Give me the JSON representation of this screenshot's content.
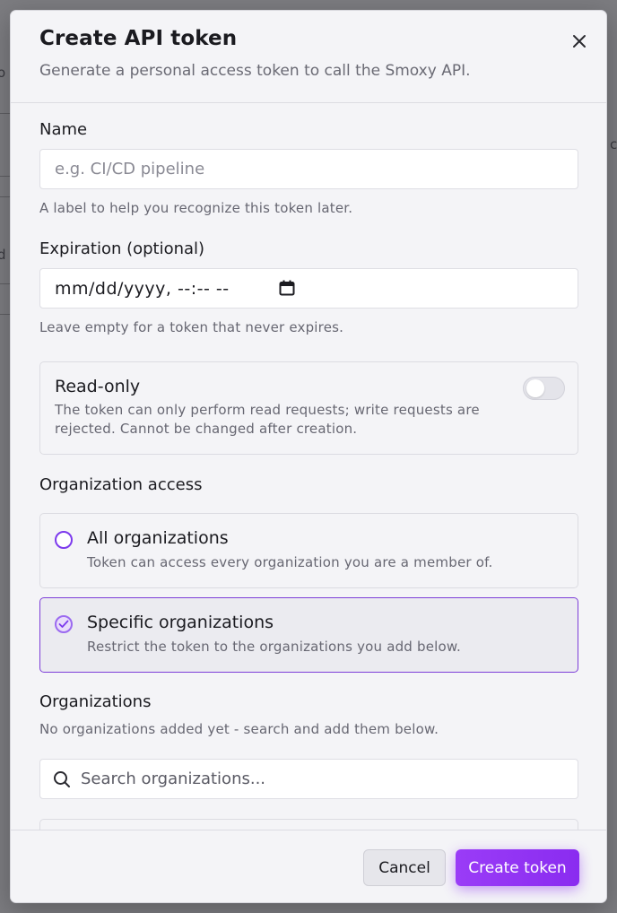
{
  "background": {
    "fragment_a": "o",
    "fragment_b": "d",
    "fragment_c": "c"
  },
  "dialog": {
    "title": "Create API token",
    "subtitle": "Generate a personal access token to call the Smoxy API.",
    "close_icon": "close-icon"
  },
  "name_field": {
    "label": "Name",
    "placeholder": "e.g. CI/CD pipeline",
    "hint": "A label to help you recognize this token later."
  },
  "expiration_field": {
    "label": "Expiration (optional)",
    "value": "mm/dd/yyyy, --:-- --",
    "calendar_icon": "calendar-icon",
    "hint": "Leave empty for a token that never expires."
  },
  "read_only": {
    "title": "Read-only",
    "description": "The token can only perform read requests; write requests are rejected. Cannot be changed after creation.",
    "enabled": false
  },
  "organization_access": {
    "label": "Organization access",
    "options": [
      {
        "title": "All organizations",
        "description": "Token can access every organization you are a member of.",
        "selected": false
      },
      {
        "title": "Specific organizations",
        "description": "Restrict the token to the organizations you add below.",
        "selected": true
      }
    ]
  },
  "organizations": {
    "label": "Organizations",
    "empty_text": "No organizations added yet - search and add them below.",
    "search_placeholder": "Search organizations..."
  },
  "footer": {
    "cancel_label": "Cancel",
    "submit_label": "Create token"
  },
  "colors": {
    "accent": "#8a2cf0",
    "selected_border": "#7d3ed8"
  }
}
